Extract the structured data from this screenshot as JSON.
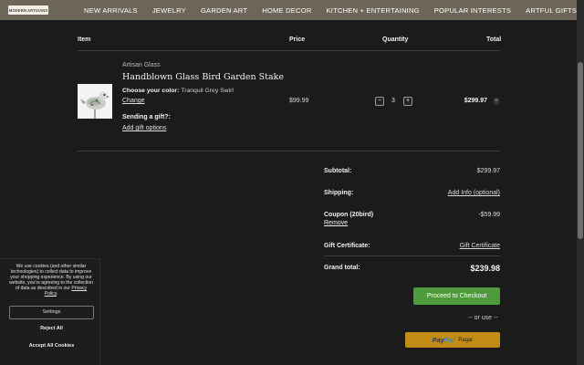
{
  "header": {
    "logo_text": "MODERN ARTISANS",
    "nav": [
      "NEW ARRIVALS",
      "JEWELRY",
      "GARDEN ART",
      "HOME DECOR",
      "KITCHEN + ENTERTAINING",
      "POPULAR INTERESTS",
      "ARTFUL GIFTS"
    ]
  },
  "cart": {
    "columns": {
      "item": "Item",
      "price": "Price",
      "quantity": "Quantity",
      "total": "Total"
    },
    "line_item": {
      "brand": "Artisan Glass",
      "name": "Handblown Glass Bird Garden Stake",
      "option_label": "Choose your color:",
      "option_value": "Tranquil Grey Swirl",
      "change_link": "Change",
      "gift_question": "Sending a gift?:",
      "gift_link": "Add gift options",
      "price": "$99.99",
      "quantity": "3",
      "minus": "−",
      "plus": "+",
      "line_total": "$299.97",
      "remove_glyph": "×",
      "image_icon": "glass-bird-image"
    }
  },
  "summary": {
    "subtotal_label": "Subtotal:",
    "subtotal_value": "$299.97",
    "shipping_label": "Shipping:",
    "shipping_value": "Add Info (optional)",
    "coupon_label": "Coupon (20bird)",
    "coupon_remove": "Remove",
    "coupon_value": "-$59.99",
    "gift_cert_label": "Gift Certificate:",
    "gift_cert_value": "Gift Certificate",
    "grand_label": "Grand total:",
    "grand_value": "$239.98",
    "checkout_button": "Proceed to Checkout",
    "or_use": "-- or use --",
    "paypal_pay": "Pay",
    "paypal_pal": "Pal",
    "paypal_text": "Pagar"
  },
  "cookie_banner": {
    "text": "We use cookies (and other similar technologies) to collect data to improve your shopping experience. By using our website, you're agreeing to the collection of data as described in our",
    "policy_link": "Privacy Policy",
    "settings_button": "Settings",
    "reject_button": "Reject All",
    "accept_button": "Accept All Cookies"
  },
  "colors": {
    "header_bg": "#6d6658",
    "page_bg": "#1b1b1b",
    "checkout_green": "#4f9a3b",
    "paypal_gold": "#c48a16"
  }
}
